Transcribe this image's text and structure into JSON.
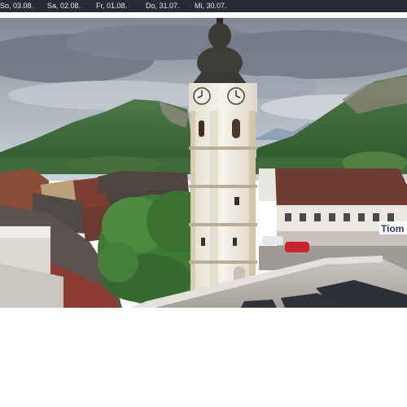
{
  "date_bar": {
    "days": [
      "So, 03.08.",
      "Sa, 02.08.",
      "Fr, 01.08.",
      "Do, 31.07.",
      "Mi, 30.07."
    ]
  },
  "webcam": {
    "sign_text": "Tiom",
    "colors": {
      "bar_bg": "#262b36",
      "bar_text": "#e6e9ef",
      "sky": "#8e9aa6",
      "mountain": "#3d6b3a",
      "tower": "#f2eee4",
      "dome": "#3b3a36",
      "roof_red": "#7a4a3c"
    }
  }
}
